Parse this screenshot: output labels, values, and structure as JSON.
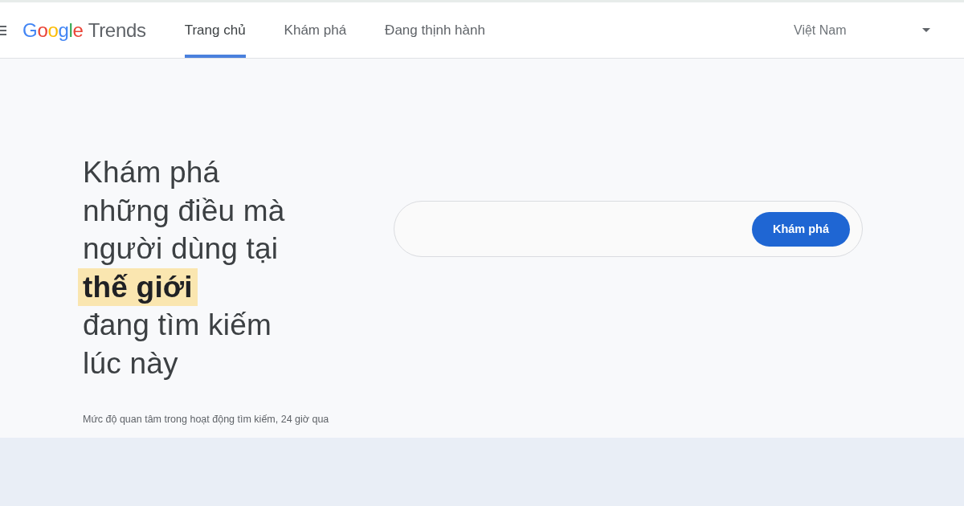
{
  "header": {
    "logo": {
      "brand": "Google",
      "product": "Trends"
    },
    "tabs": [
      {
        "label": "Trang chủ",
        "selected": true
      },
      {
        "label": "Khám phá",
        "selected": false
      },
      {
        "label": "Đang thịnh hành",
        "selected": false
      }
    ],
    "country_select": {
      "value": "Việt Nam"
    }
  },
  "hero": {
    "headline": "Khám phá những điều mà người dùng tại **thế giới** đang tìm kiếm lúc này",
    "search": {
      "button": "Khám phá"
    },
    "caption": "Mức độ quan tâm trong hoạt động tìm kiếm, 24 giờ qua"
  }
}
